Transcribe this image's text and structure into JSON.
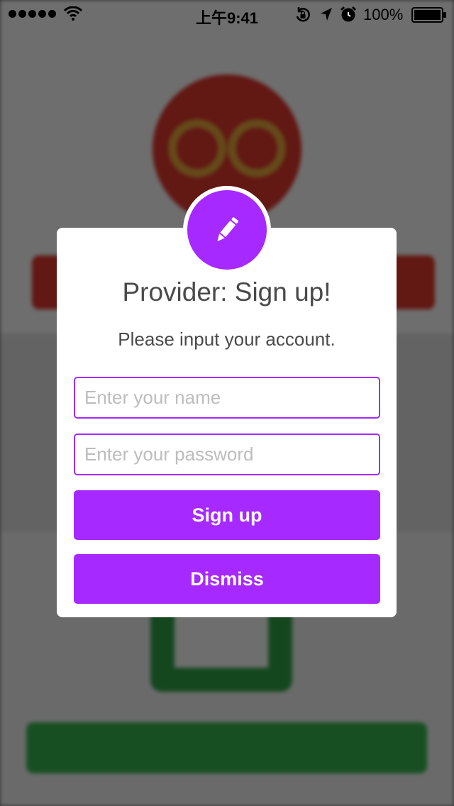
{
  "status_bar": {
    "time": "上午9:41",
    "battery_percent": "100%",
    "signal_bars": 5,
    "icons": [
      "wifi-icon",
      "rotation-lock-icon",
      "location-arrow-icon",
      "alarm-clock-icon",
      "battery-icon"
    ]
  },
  "modal": {
    "icon": "pencil-icon",
    "title": "Provider: Sign up!",
    "subtitle": "Please input your account.",
    "name_placeholder": "Enter your name",
    "password_placeholder": "Enter your password",
    "signup_label": "Sign up",
    "dismiss_label": "Dismiss"
  },
  "colors": {
    "accent": "#a629ff",
    "overlay": "#000000",
    "background_red": "#d9352b",
    "background_green": "#35b04c"
  }
}
